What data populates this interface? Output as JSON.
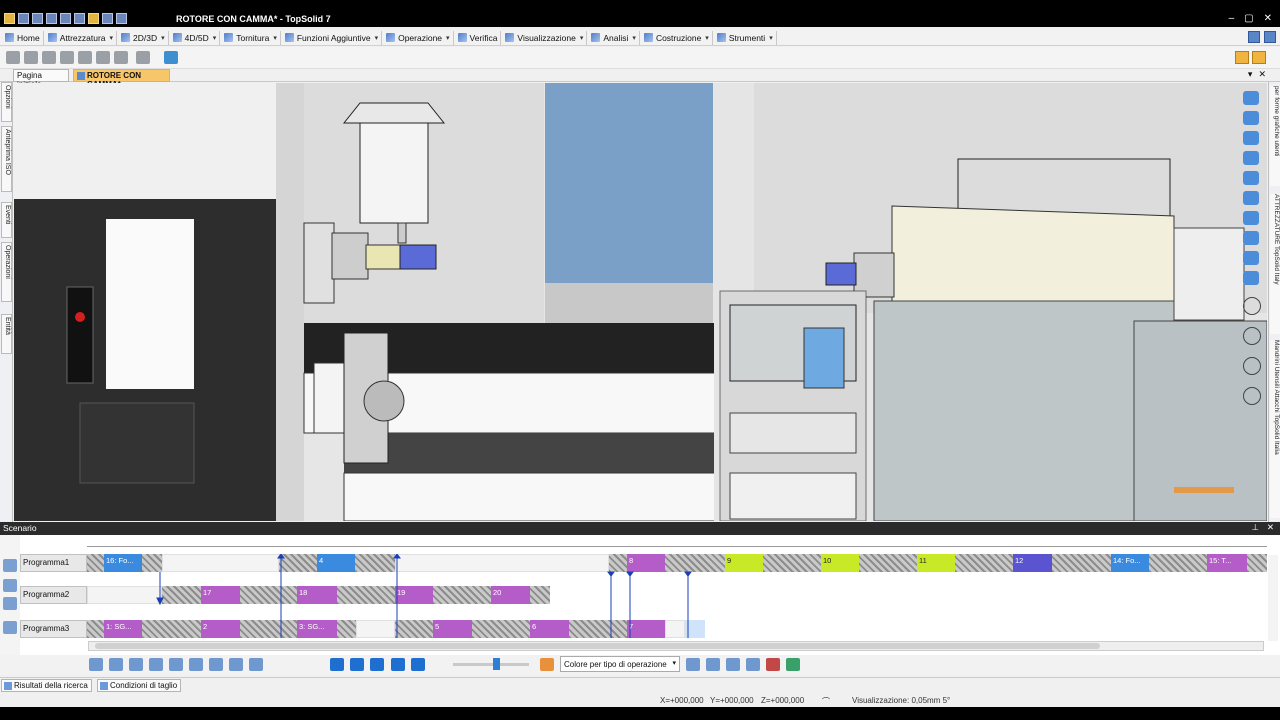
{
  "window": {
    "title": "ROTORE CON CAMMA* - TopSolid 7"
  },
  "menu": [
    {
      "label": "Home",
      "dropdown": false
    },
    {
      "label": "Attrezzatura",
      "dropdown": true
    },
    {
      "label": "2D/3D",
      "dropdown": true
    },
    {
      "label": "4D/5D",
      "dropdown": true
    },
    {
      "label": "Tornitura",
      "dropdown": true
    },
    {
      "label": "Funzioni Aggiuntive",
      "dropdown": true
    },
    {
      "label": "Operazione",
      "dropdown": true
    },
    {
      "label": "Verifica",
      "dropdown": false
    },
    {
      "label": "Visualizzazione",
      "dropdown": true
    },
    {
      "label": "Analisi",
      "dropdown": true
    },
    {
      "label": "Costruzione",
      "dropdown": true
    },
    {
      "label": "Strumenti",
      "dropdown": true
    }
  ],
  "doc_tabs": {
    "home": "Pagina iniziale",
    "active": "ROTORE CON CAMMA*"
  },
  "left_panels": [
    "Opzioni",
    "Anteprima ISO",
    "Eventi",
    "Operazioni",
    "Entità"
  ],
  "right_panels": [
    "per forme grafiche utenti",
    "ATTREZZATURE TopSolid Italy",
    "Mandrini Utensili Attacchi TopSolid Italia"
  ],
  "scenario": {
    "title": "Scenario",
    "programs": [
      {
        "name": "Programma1",
        "segments": [
          {
            "kind": "hatch",
            "start": 0,
            "end": 17,
            "label": ""
          },
          {
            "kind": "blue",
            "start": 17,
            "end": 55,
            "label": "16: Fo..."
          },
          {
            "kind": "hatch",
            "start": 55,
            "end": 75,
            "label": ""
          },
          {
            "kind": "gap",
            "start": 75,
            "end": 192,
            "label": ""
          },
          {
            "kind": "hatch",
            "start": 192,
            "end": 230,
            "label": ""
          },
          {
            "kind": "blue",
            "start": 230,
            "end": 268,
            "label": "4"
          },
          {
            "kind": "hatch",
            "start": 268,
            "end": 308,
            "label": ""
          },
          {
            "kind": "gap",
            "start": 308,
            "end": 522,
            "label": ""
          },
          {
            "kind": "hatch",
            "start": 522,
            "end": 540,
            "label": ""
          },
          {
            "kind": "purple",
            "start": 540,
            "end": 578,
            "label": "8"
          },
          {
            "kind": "hatch",
            "start": 578,
            "end": 638,
            "label": ""
          },
          {
            "kind": "lime",
            "start": 638,
            "end": 676,
            "label": "9"
          },
          {
            "kind": "hatch",
            "start": 676,
            "end": 734,
            "label": ""
          },
          {
            "kind": "lime",
            "start": 734,
            "end": 772,
            "label": "10"
          },
          {
            "kind": "hatch",
            "start": 772,
            "end": 830,
            "label": ""
          },
          {
            "kind": "lime",
            "start": 830,
            "end": 868,
            "label": "11"
          },
          {
            "kind": "hatch",
            "start": 868,
            "end": 926,
            "label": ""
          },
          {
            "kind": "indigo",
            "start": 926,
            "end": 965,
            "label": "12"
          },
          {
            "kind": "hatch",
            "start": 965,
            "end": 1024,
            "label": ""
          },
          {
            "kind": "blue",
            "start": 1024,
            "end": 1062,
            "label": "14: Fo..."
          },
          {
            "kind": "hatch",
            "start": 1062,
            "end": 1120,
            "label": ""
          },
          {
            "kind": "purple",
            "start": 1120,
            "end": 1160,
            "label": "15: T..."
          },
          {
            "kind": "hatch",
            "start": 1160,
            "end": 1180,
            "label": ""
          }
        ]
      },
      {
        "name": "Programma2",
        "segments": [
          {
            "kind": "gap",
            "start": 0,
            "end": 75,
            "label": ""
          },
          {
            "kind": "hatch",
            "start": 75,
            "end": 114,
            "label": ""
          },
          {
            "kind": "purple",
            "start": 114,
            "end": 153,
            "label": "17"
          },
          {
            "kind": "hatch",
            "start": 153,
            "end": 210,
            "label": ""
          },
          {
            "kind": "purple",
            "start": 210,
            "end": 250,
            "label": "18"
          },
          {
            "kind": "hatch",
            "start": 250,
            "end": 308,
            "label": ""
          },
          {
            "kind": "purple",
            "start": 308,
            "end": 346,
            "label": "19"
          },
          {
            "kind": "hatch",
            "start": 346,
            "end": 404,
            "label": ""
          },
          {
            "kind": "purple",
            "start": 404,
            "end": 443,
            "label": "20"
          },
          {
            "kind": "hatch",
            "start": 443,
            "end": 463,
            "label": ""
          }
        ]
      },
      {
        "name": "Programma3",
        "segments": [
          {
            "kind": "hatch",
            "start": 0,
            "end": 17,
            "label": ""
          },
          {
            "kind": "purple",
            "start": 17,
            "end": 55,
            "label": "1: SG..."
          },
          {
            "kind": "hatch",
            "start": 55,
            "end": 114,
            "label": ""
          },
          {
            "kind": "purple",
            "start": 114,
            "end": 153,
            "label": "2"
          },
          {
            "kind": "hatch",
            "start": 153,
            "end": 210,
            "label": ""
          },
          {
            "kind": "purple",
            "start": 210,
            "end": 250,
            "label": "3: SG..."
          },
          {
            "kind": "hatch",
            "start": 250,
            "end": 269,
            "label": ""
          },
          {
            "kind": "gap",
            "start": 269,
            "end": 308,
            "label": ""
          },
          {
            "kind": "hatch",
            "start": 308,
            "end": 346,
            "label": ""
          },
          {
            "kind": "purple",
            "start": 346,
            "end": 385,
            "label": "5"
          },
          {
            "kind": "hatch",
            "start": 385,
            "end": 443,
            "label": ""
          },
          {
            "kind": "purple",
            "start": 443,
            "end": 482,
            "label": "6"
          },
          {
            "kind": "hatch",
            "start": 482,
            "end": 540,
            "label": ""
          },
          {
            "kind": "purple",
            "start": 540,
            "end": 578,
            "label": "7"
          },
          {
            "kind": "gap",
            "start": 578,
            "end": 598,
            "label": ""
          },
          {
            "kind": "lightblue",
            "start": 598,
            "end": 618,
            "label": ""
          }
        ]
      }
    ],
    "color_mode_select": "Colore per tipo di operazione"
  },
  "bottom_tabs": [
    "Risultati della ricerca",
    "Condizioni di taglio"
  ],
  "status": {
    "x": "X=+000,000",
    "y": "Y=+000,000",
    "z": "Z=+000,000",
    "visualization": "Visualizzazione: 0,05mm 5°"
  },
  "colors": {
    "blue": "#3a8be0",
    "purple": "#b45cc8",
    "lime": "#c8ea26",
    "indigo": "#5a54d0",
    "active_tab": "#f7c66a"
  }
}
